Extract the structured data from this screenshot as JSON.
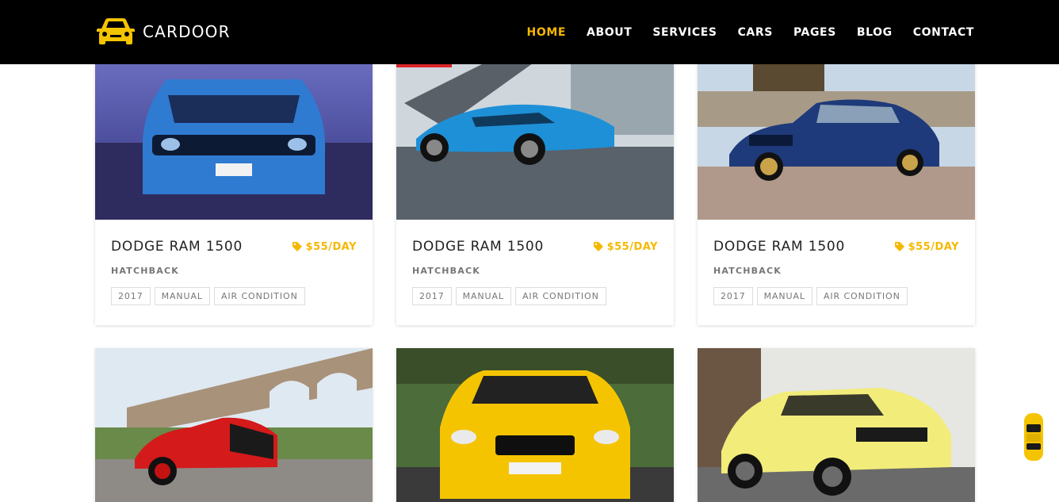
{
  "brand": {
    "name": "CARDOOR",
    "logo_icon": "car-front-icon",
    "accent": "#f5b800"
  },
  "nav": {
    "items": [
      {
        "label": "HOME",
        "active": true
      },
      {
        "label": "ABOUT",
        "active": false
      },
      {
        "label": "SERVICES",
        "active": false
      },
      {
        "label": "CARS",
        "active": false
      },
      {
        "label": "PAGES",
        "active": false
      },
      {
        "label": "BLOG",
        "active": false
      },
      {
        "label": "CONTACT",
        "active": false
      }
    ]
  },
  "cars": [
    {
      "name": "DODGE RAM 1500",
      "price": "$55/DAY",
      "type": "HATCHBACK",
      "features": [
        "2017",
        "MANUAL",
        "AIR CONDITION"
      ],
      "image": "blue-sedan-lakeside"
    },
    {
      "name": "DODGE RAM 1500",
      "price": "$55/DAY",
      "type": "HATCHBACK",
      "features": [
        "2017",
        "MANUAL",
        "AIR CONDITION"
      ],
      "image": "blue-sportscar-modern-building"
    },
    {
      "name": "DODGE RAM 1500",
      "price": "$55/DAY",
      "type": "HATCHBACK",
      "features": [
        "2017",
        "MANUAL",
        "AIR CONDITION"
      ],
      "image": "navy-coupe-gold-wheels"
    },
    {
      "image": "red-coupe-viaduct"
    },
    {
      "image": "yellow-coupe-front-field"
    },
    {
      "image": "pale-yellow-coupe-garage"
    }
  ],
  "scroll_widget": {
    "icon": "yellow-car-top-icon"
  }
}
